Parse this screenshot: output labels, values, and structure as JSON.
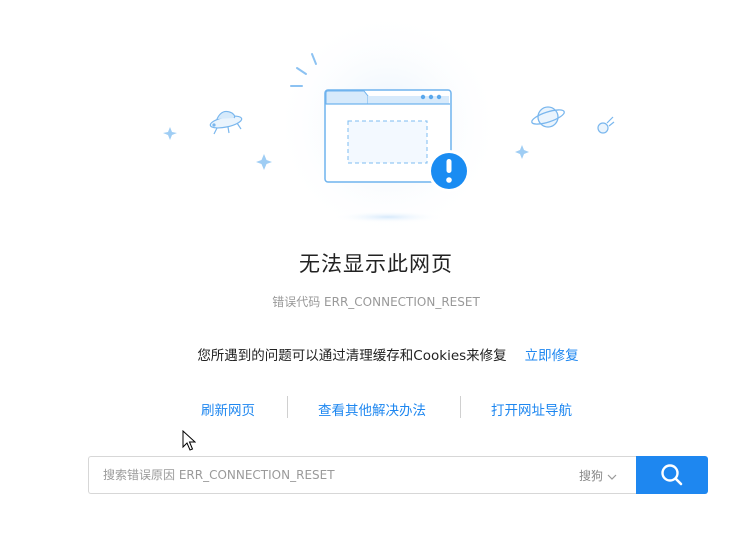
{
  "error": {
    "title": "无法显示此网页",
    "code_text": "错误代码 ERR_CONNECTION_RESET"
  },
  "hint": {
    "text": "您所遇到的问题可以通过清理缓存和Cookies来修复",
    "fix_link": "立即修复"
  },
  "links": {
    "refresh": "刷新网页",
    "other_solutions": "查看其他解决办法",
    "open_nav": "打开网址导航"
  },
  "search": {
    "placeholder": "搜索错误原因 ERR_CONNECTION_RESET",
    "engine": "搜狗"
  },
  "colors": {
    "accent": "#1e87f0",
    "alert": "#1a8cf2",
    "title": "#222222",
    "muted": "#999999"
  },
  "icons": [
    "browser-window-icon",
    "alert-exclamation-icon",
    "ufo-icon",
    "planet-icon",
    "comet-icon",
    "sparkle-icon",
    "search-icon",
    "chevron-down-icon",
    "mouse-cursor-icon"
  ]
}
